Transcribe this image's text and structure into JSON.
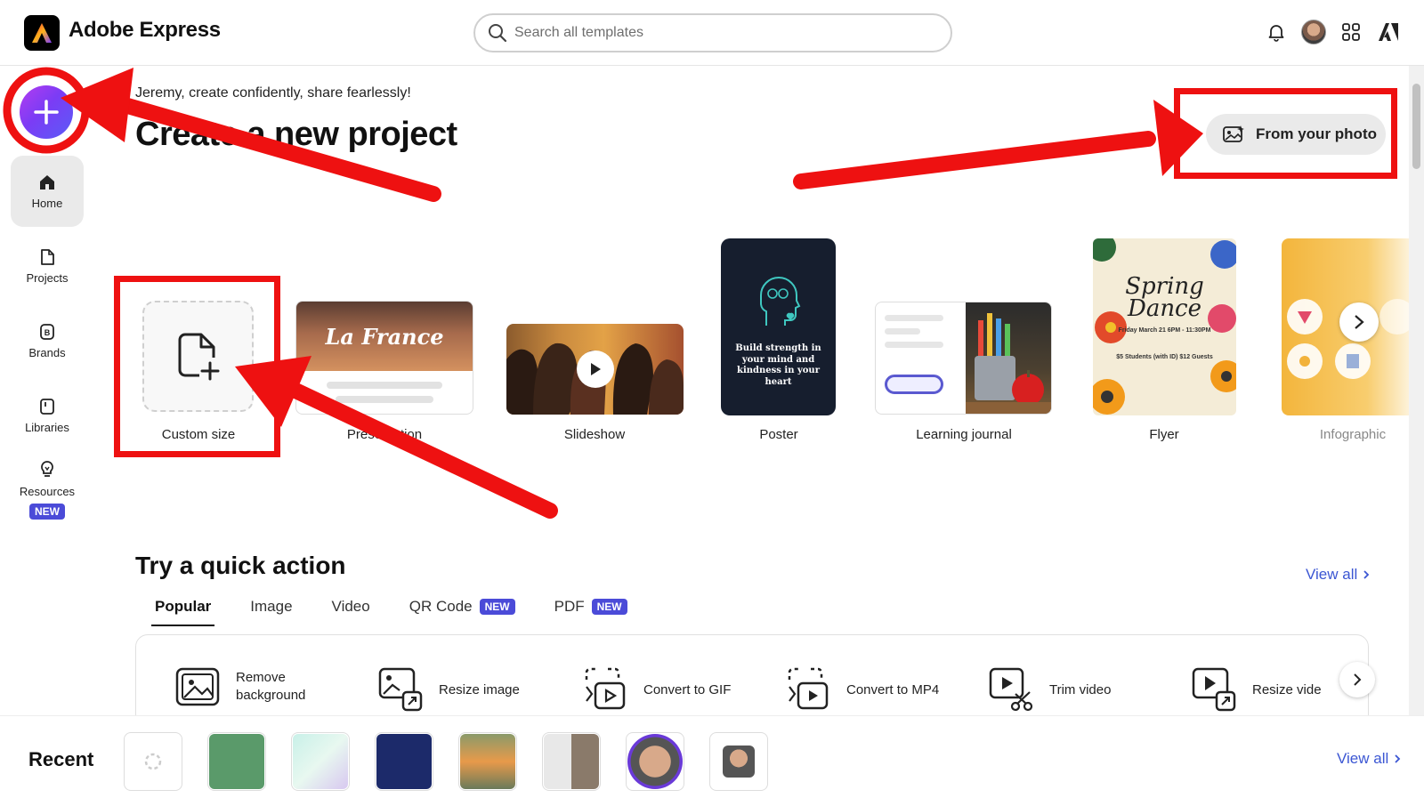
{
  "app": {
    "name": "Adobe Express"
  },
  "search": {
    "placeholder": "Search all templates"
  },
  "topbar_icons": [
    "bell-icon",
    "avatar",
    "apps-grid-icon",
    "adobe-logo-icon"
  ],
  "rail": {
    "items": [
      {
        "label": "Home",
        "icon": "home-icon",
        "active": true
      },
      {
        "label": "Projects",
        "icon": "file-icon"
      },
      {
        "label": "Brands",
        "icon": "brand-icon"
      },
      {
        "label": "Libraries",
        "icon": "library-icon"
      },
      {
        "label": "Resources",
        "icon": "lightbulb-icon",
        "badge": "NEW"
      }
    ]
  },
  "hero": {
    "greeting": "Jeremy, create confidently, share fearlessly!",
    "title": "Create a new project",
    "from_photo": "From your photo"
  },
  "templates": [
    {
      "label": "Custom size"
    },
    {
      "label": "Presentation",
      "thumb_text": "La France"
    },
    {
      "label": "Slideshow"
    },
    {
      "label": "Poster",
      "thumb_text": "Build strength in your mind and kindness in your heart"
    },
    {
      "label": "Learning journal"
    },
    {
      "label": "Flyer",
      "thumb_title": "Spring Dance",
      "thumb_sub": "Friday March 21 6PM - 11:30PM",
      "thumb_price": "$5 Students (with ID) $12 Guests"
    },
    {
      "label": "Infographic"
    }
  ],
  "quick_action": {
    "title": "Try a quick action",
    "view_all": "View all",
    "tabs": [
      {
        "label": "Popular",
        "active": true
      },
      {
        "label": "Image"
      },
      {
        "label": "Video"
      },
      {
        "label": "QR Code",
        "badge": "NEW"
      },
      {
        "label": "PDF",
        "badge": "NEW"
      }
    ],
    "items": [
      {
        "label": "Remove background",
        "icon": "remove-background-icon"
      },
      {
        "label": "Resize image",
        "icon": "resize-image-icon"
      },
      {
        "label": "Convert to GIF",
        "icon": "convert-gif-icon"
      },
      {
        "label": "Convert to MP4",
        "icon": "convert-mp4-icon"
      },
      {
        "label": "Trim video",
        "icon": "trim-video-icon"
      },
      {
        "label": "Resize video",
        "icon": "resize-video-icon"
      }
    ]
  },
  "recent": {
    "label": "Recent",
    "view_all": "View all"
  },
  "colors": {
    "accent": "#3b56d3",
    "badge": "#4b4bd8",
    "annotation": "#ee1111"
  }
}
